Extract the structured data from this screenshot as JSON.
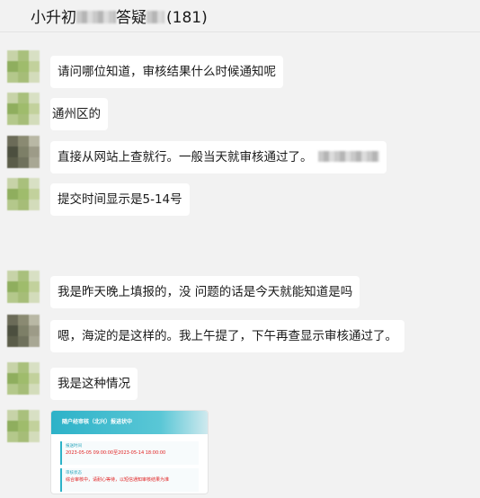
{
  "header": {
    "title_part1": "小升初",
    "title_part2": "答疑",
    "member_count": "(181)"
  },
  "messages": [
    {
      "text": "请问哪位知道，审核结果什么时候通知呢"
    },
    {
      "text": "通州区的"
    },
    {
      "text": "直接从网站上查就行。一般当天就审核通过了。"
    },
    {
      "text": "提交时间显示是5-14号"
    },
    {
      "text": "我是昨天晚上填报的，没 问题的话是今天就能知道是吗"
    },
    {
      "text": "嗯，海淀的是这样的。我上午提了，下午再查显示审核通过了。"
    },
    {
      "text": "我是这种情况"
    }
  ],
  "image_message": {
    "header": "随户经审核（北兴）报进状中",
    "label1": "报送时间",
    "submit_time": "2023-05-05 09:00:00至2023-05-14 18:00:00",
    "label2": "审核状态",
    "status": "综合审核中，请耐心等待，以短信通知审核结果为准"
  },
  "colors": {
    "bubble": "#ffffff",
    "background": "#f2f2f2",
    "accent": "#2db2c8",
    "alert": "#e02020"
  }
}
